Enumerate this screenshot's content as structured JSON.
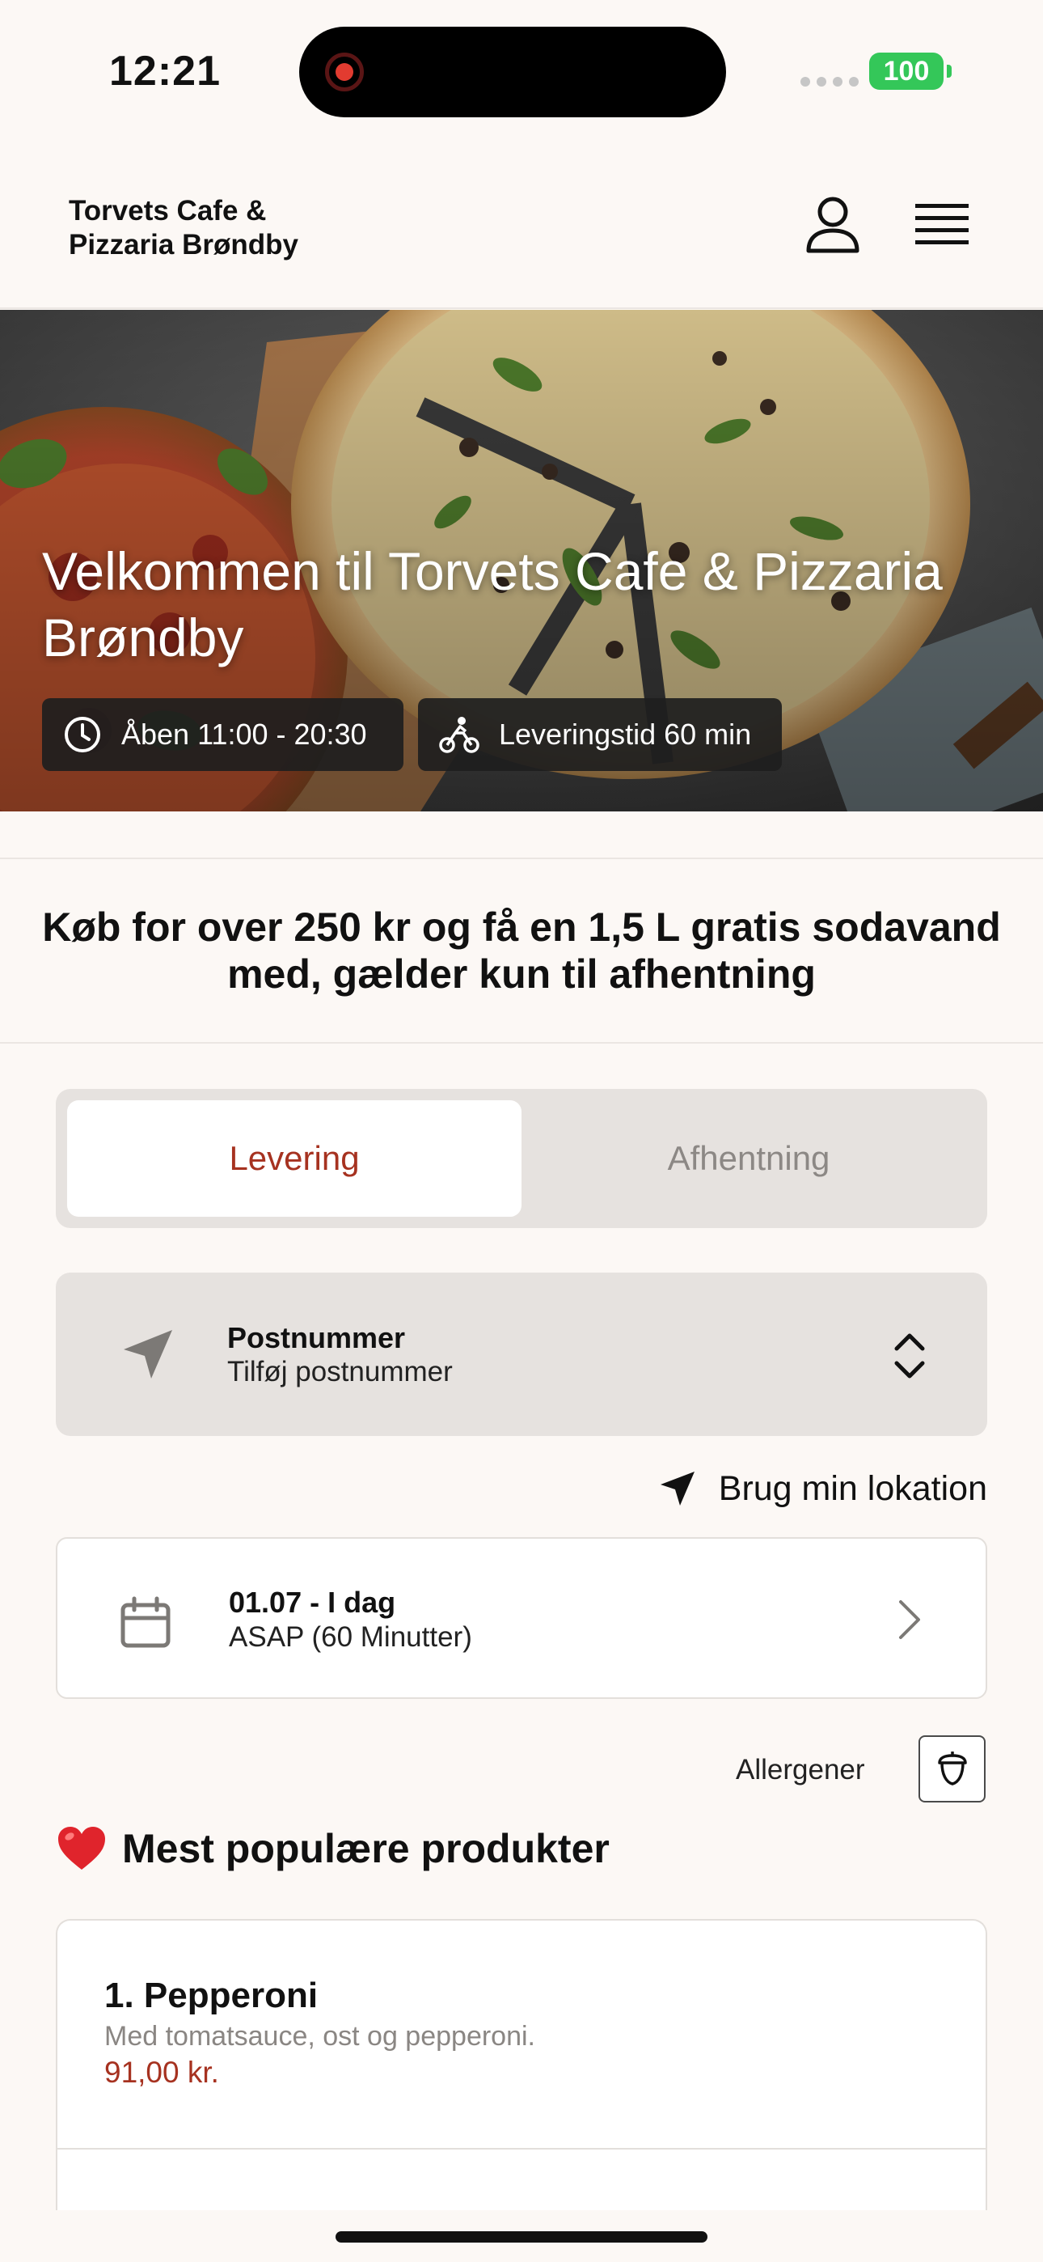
{
  "status_bar": {
    "time": "12:21",
    "battery": "100"
  },
  "header": {
    "restaurant_name": "Torvets Cafe & Pizzaria Brøndby"
  },
  "hero": {
    "title": "Velkommen til Torvets Cafe & Pizzaria Brøndby",
    "opening_hours": "Åben 11:00 - 20:30",
    "delivery_time": "Leveringstid 60 min"
  },
  "promo": {
    "text": "Køb for over 250 kr og få en 1,5 L gratis sodavand med, gælder kun til afhentning"
  },
  "order_mode": {
    "tabs": [
      {
        "label": "Levering",
        "selected": true
      },
      {
        "label": "Afhentning",
        "selected": false
      }
    ]
  },
  "postcode": {
    "label": "Postnummer",
    "value": "Tilføj postnummer"
  },
  "use_location": {
    "label": "Brug min lokation"
  },
  "date_time": {
    "date": "01.07 - I dag",
    "time": "ASAP (60 Minutter)"
  },
  "allergens": {
    "label": "Allergener"
  },
  "popular": {
    "heading": "Mest populære produkter",
    "products": [
      {
        "name": "1. Pepperoni",
        "description": "Med tomatsauce, ost og pepperoni.",
        "price": "91,00 kr."
      }
    ]
  },
  "colors": {
    "accent": "#a63220",
    "background": "#fcf8f5",
    "panel": "#e6e2df"
  }
}
